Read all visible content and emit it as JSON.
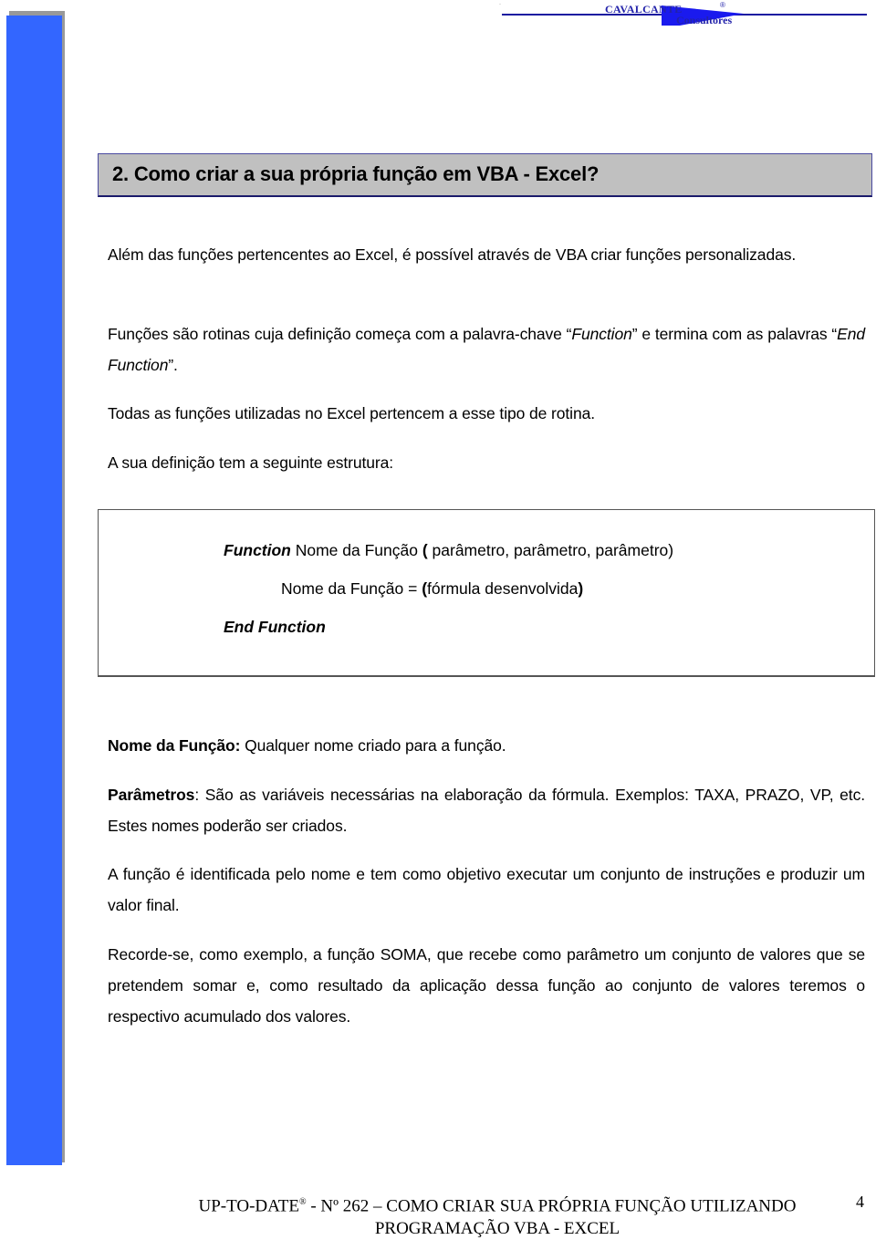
{
  "logo": {
    "line1": "CAVALCANTE",
    "line2": "Consultores",
    "registered": "®",
    "brand_color": "#2222aa"
  },
  "sidebar": {
    "color": "#3366ff",
    "shadow_color": "#999999"
  },
  "heading": {
    "text": "2. Como criar a sua própria função em VBA - Excel?",
    "background": "#c0c0c0"
  },
  "paragraphs": {
    "p1": "Além das funções pertencentes ao Excel, é possível através de VBA criar funções personalizadas.",
    "p2_a": "Funções são rotinas cuja definição começa com a palavra-chave “",
    "p2_kw1": "Function",
    "p2_b": "” e termina com as palavras “",
    "p2_kw2": "End Function",
    "p2_c": "”.",
    "p3": "Todas as funções utilizadas no Excel pertencem a esse tipo de rotina.",
    "p4": "A sua definição tem a seguinte estrutura:"
  },
  "code": {
    "kw_function": "Function",
    "signature_name": " Nome da Função ",
    "paren_open": "(",
    "params": " parâmetro, parâmetro, parâmetro)",
    "body_name": "Nome da Função  = ",
    "body_paren_open": "(",
    "body_formula": "fórmula desenvolvida",
    "body_paren_close": ")",
    "kw_end": "End Function"
  },
  "definitions": {
    "name_label": "Nome da Função:",
    "name_text": " Qualquer nome criado para a função.",
    "params_label": "Parâmetros",
    "params_text": ": São as variáveis necessárias na elaboração da fórmula.   Exemplos: TAXA, PRAZO, VP, etc. Estes nomes poderão ser criados."
  },
  "closing": {
    "p5": "A função é identificada pelo nome e tem como objetivo executar um conjunto de instruções e produzir um valor final.",
    "p6": "Recorde-se, como exemplo, a função SOMA, que recebe como parâmetro um conjunto de valores que se pretendem somar e, como resultado da aplicação dessa função ao conjunto de valores teremos o respectivo acumulado dos valores."
  },
  "footer": {
    "prefix": "UP-TO-DATE",
    "registered": "®",
    "issue": " - Nº 262 – COMO CRIAR SUA PRÓPRIA FUNÇÃO UTILIZANDO",
    "line2": "PROGRAMAÇÃO VBA - EXCEL",
    "page_number": "4"
  }
}
